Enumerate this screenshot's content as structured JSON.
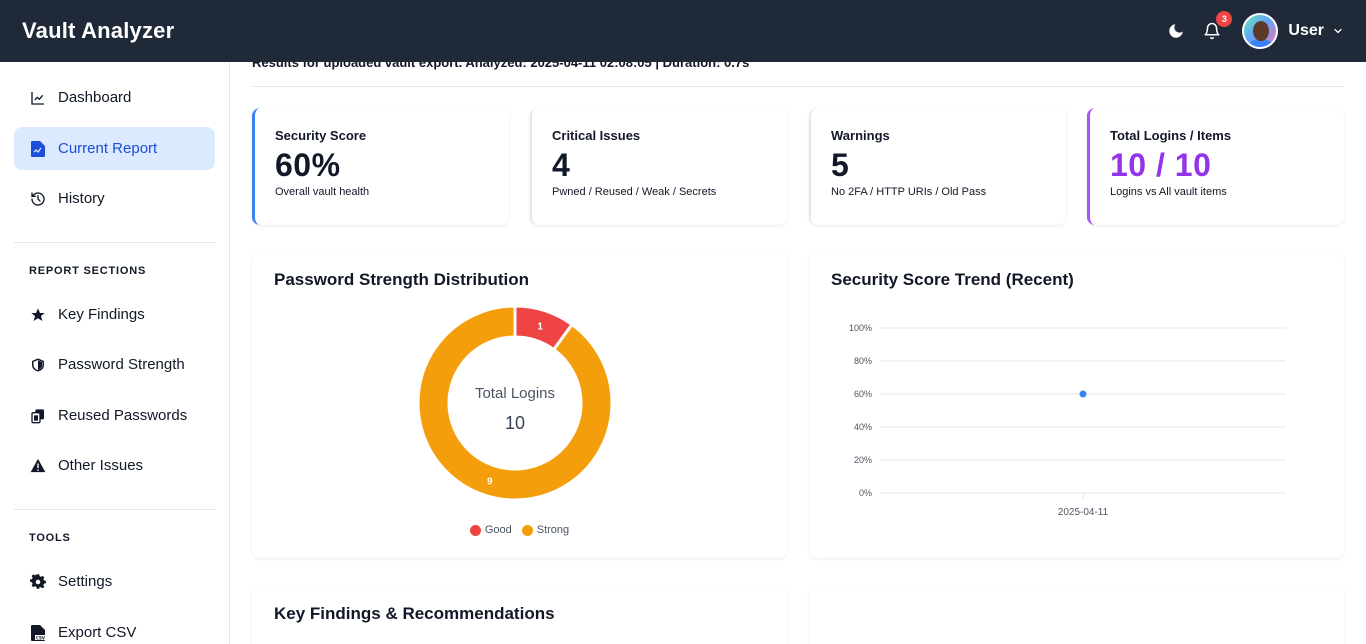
{
  "header": {
    "title": "Vault Analyzer",
    "notification_count": "3",
    "user_label": "User"
  },
  "sidebar": {
    "items": [
      {
        "label": "Dashboard",
        "icon": "chart-line-icon"
      },
      {
        "label": "Current Report",
        "icon": "file-report-icon"
      },
      {
        "label": "History",
        "icon": "history-icon"
      }
    ],
    "report_sections_label": "REPORT SECTIONS",
    "report_sections": [
      {
        "label": "Key Findings",
        "icon": "star-icon"
      },
      {
        "label": "Password Strength",
        "icon": "shield-icon"
      },
      {
        "label": "Reused Passwords",
        "icon": "copy-icon"
      },
      {
        "label": "Other Issues",
        "icon": "warning-icon"
      }
    ],
    "tools_label": "TOOLS",
    "tools": [
      {
        "label": "Settings",
        "icon": "gear-icon"
      },
      {
        "label": "Export CSV",
        "icon": "csv-file-icon"
      }
    ]
  },
  "main": {
    "results_text": "Results for uploaded vault export. Analyzed: 2025-04-11 02:08:05  |  Duration: 0.7s",
    "stats": [
      {
        "label": "Security Score",
        "value": "60%",
        "sub": "Overall vault health"
      },
      {
        "label": "Critical Issues",
        "value": "4",
        "sub": "Pwned / Reused / Weak / Secrets"
      },
      {
        "label": "Warnings",
        "value": "5",
        "sub": "No 2FA / HTTP URIs / Old Pass"
      },
      {
        "label": "Total Logins / Items",
        "value": "10 / 10",
        "sub": "Logins vs All vault items"
      }
    ],
    "strength_panel_title": "Password Strength Distribution",
    "donut_center_label": "Total Logins",
    "donut_center_value": "10",
    "trend_panel_title": "Security Score Trend (Recent)",
    "findings_title": "Key Findings & Recommendations"
  },
  "chart_data": [
    {
      "type": "pie",
      "title": "",
      "categories": [
        "Good",
        "Strong"
      ],
      "values": [
        1,
        9
      ],
      "colors": [
        "#ef4444",
        "#f59e0b"
      ],
      "legend": "bottom"
    },
    {
      "type": "line",
      "title": "",
      "x": [
        "2025-04-11"
      ],
      "series": [
        {
          "values": [
            60
          ]
        }
      ],
      "ylim": [
        0,
        100
      ],
      "yticks": [
        "0%",
        "20%",
        "40%",
        "60%",
        "80%",
        "100%"
      ],
      "grid": true,
      "color": "#3b82f6"
    }
  ]
}
